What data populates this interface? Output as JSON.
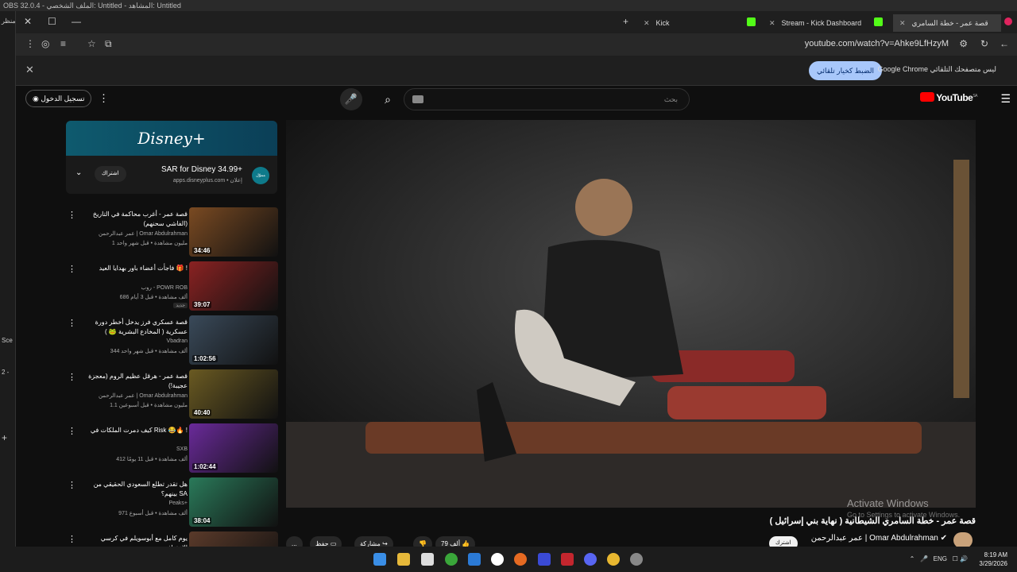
{
  "obs": {
    "title": "OBS 32.0.4 - الملف الشخصي: Untitled - المشاهد: Untitled",
    "side_labels": [
      "منظر",
      "Sce",
      "2 -",
      "+"
    ]
  },
  "tabs": [
    {
      "label": "Kick"
    },
    {
      "label": "Stream - Kick Dashboard"
    },
    {
      "label": "قصة عمر - خطة السامري ..."
    }
  ],
  "address": {
    "url": "youtube.com/watch?v=Ahke9LfHzyM"
  },
  "infobar": {
    "text": "Google Chrome ليس متصفحك التلقائي",
    "button": "الضبط كخيار تلقائي"
  },
  "header": {
    "signin": "تسجيل الدخول",
    "search_placeholder": "بحث",
    "logo": "YouTube",
    "region": "SA"
  },
  "ad": {
    "banner": "Disney+",
    "title": "SAR for Disney 34.99+",
    "ad_label": "إعلان",
    "domain": "apps.disneyplus.com",
    "cta": "اشتراك",
    "sponsor": "مموّل"
  },
  "videos": [
    {
      "title": "قصة عمر - أغرب محاكمة في التاريخ (الفاشي سحنهم)",
      "channel": "عمر عبدالرحمن | Omar Abdulrahman",
      "meta": "1 مليون مشاهدة • قبل شهر واحد",
      "duration": "34:46",
      "new": "",
      "thumb_color": "#7a4a22"
    },
    {
      "title": "فاجأت أعضاء باور بهدايا العيد 🎁 !",
      "channel": "روب - POWR ROB",
      "meta": "686 ألف مشاهدة • قبل 3 أيام",
      "duration": "39:07",
      "new": "جديد",
      "thumb_color": "#8a2222"
    },
    {
      "title": "قصة عسكري فرز يدخل أخطر دورة عسكرية ( المخادع البشرية 🐸 )",
      "channel": "Vbadran",
      "meta": "344 ألف مشاهدة • قبل شهر واحد",
      "duration": "1:02:56",
      "new": "",
      "thumb_color": "#3a4a5a"
    },
    {
      "title": "قصة عمر - هرقل عظيم الروم (معجزة عجيبة!)",
      "channel": "عمر عبدالرحمن | Omar Abdulrahman",
      "meta": "1.1 مليون مشاهدة • قبل أسبوعين",
      "duration": "40:40",
      "new": "",
      "thumb_color": "#6a5a22"
    },
    {
      "title": "كيف دمرت الملكات في Risk 😂🔥 !",
      "channel": "SXB",
      "meta": "412 ألف مشاهدة • قبل 11 يومًا",
      "duration": "1:02:44",
      "new": "",
      "thumb_color": "#6a2a9a"
    },
    {
      "title": "هل تقدر تطلع السعودي الحقيقي من بينهم؟ SA",
      "channel": "Peaks+",
      "meta": "971 ألف مشاهدة • قبل أسبوع",
      "duration": "38:04",
      "new": "",
      "thumb_color": "#2a7a5a"
    },
    {
      "title": "يوم كامل مع أبوسويلم في كرسي الاعتراف",
      "channel": "",
      "meta": "",
      "duration": "",
      "new": "",
      "thumb_color": "#5a3a2a"
    }
  ],
  "video": {
    "title": "قصة عمر - خطة السامري الشيطانية ( نهاية بني إسرائيل )",
    "channel": "عمر عبدالرحمن | Omar Abdulrahman",
    "subscribe": "اشترك",
    "likes": "79 ألف",
    "share": "مشاركة",
    "save": "حفظ",
    "more": "..."
  },
  "watermark": {
    "line1": "Activate Windows",
    "line2": "Go to Settings to activate Windows."
  },
  "taskbar": {
    "lang": "ENG",
    "time": "8:19 AM",
    "date": "3/29/2026"
  }
}
